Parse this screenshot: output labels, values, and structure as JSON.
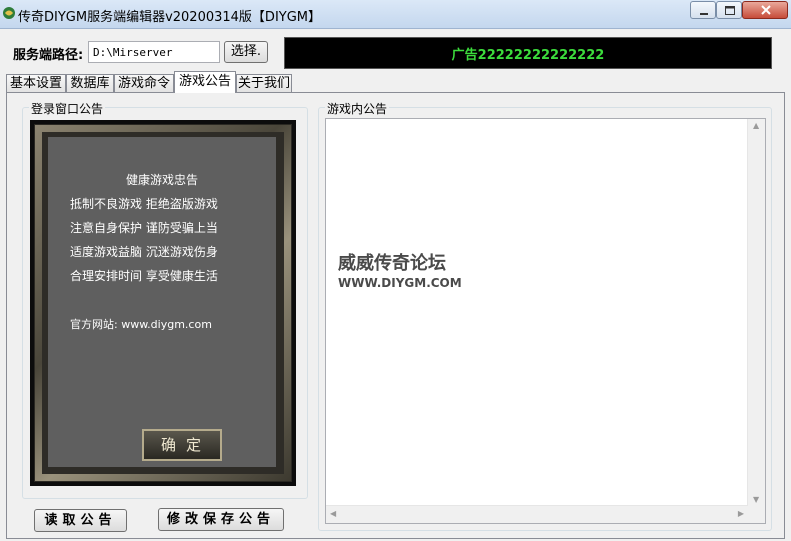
{
  "window": {
    "title": "传奇DIYGM服务端编辑器v20200314版【DIYGM】"
  },
  "server_path": {
    "label": "服务端路径:",
    "value": "D:\\Mirserver",
    "browse_label": "选择."
  },
  "ad": {
    "text": "广告22222222222222"
  },
  "tabs": [
    {
      "label": "基本设置"
    },
    {
      "label": "数据库"
    },
    {
      "label": "游戏命令"
    },
    {
      "label": "游戏公告",
      "active": true
    },
    {
      "label": "关于我们"
    }
  ],
  "login_group": {
    "title": "登录窗口公告",
    "heading": "健康游戏忠告",
    "lines": [
      "抵制不良游戏   拒绝盗版游戏",
      "注意自身保护   谨防受骗上当",
      "适度游戏益脑   沉迷游戏伤身",
      "合理安排时间   享受健康生活"
    ],
    "website": "官方网站: www.diygm.com",
    "ok_label": "确定"
  },
  "buttons": {
    "read": "读取公告",
    "save": "修改保存公告"
  },
  "ingame_group": {
    "title": "游戏内公告",
    "watermark_title": "威威传奇论坛",
    "watermark_url": "WWW.DIYGM.COM"
  }
}
